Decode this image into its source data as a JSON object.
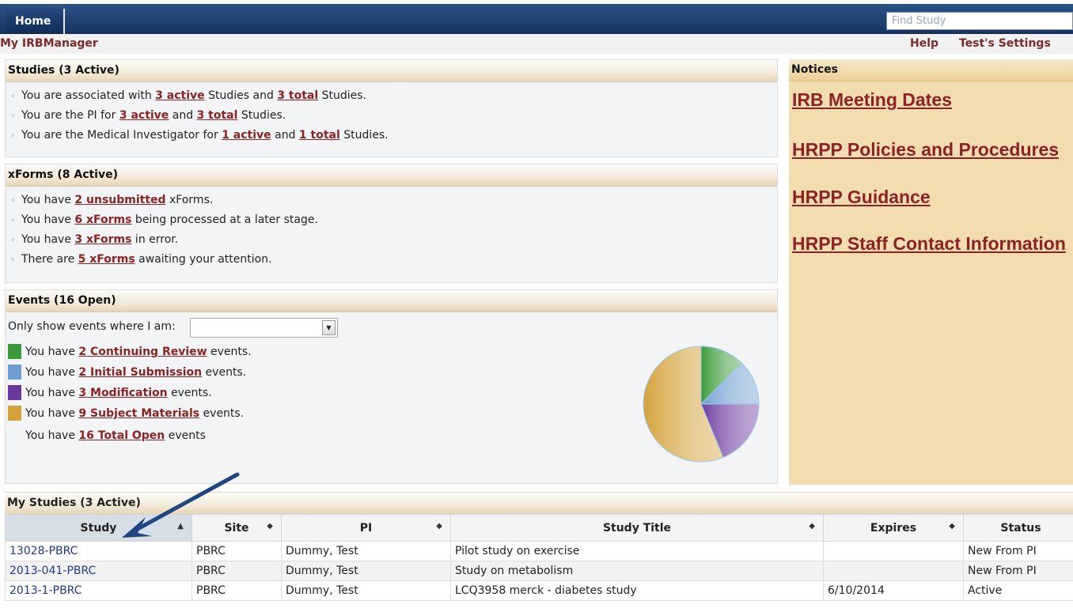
{
  "topbar": {
    "home_tab": "Home",
    "search_placeholder": "Find Study"
  },
  "subbar": {
    "app_name": "My IRBManager",
    "help": "Help",
    "settings": "Test's Settings"
  },
  "studies_panel": {
    "title": "Studies (3 Active)",
    "lines": [
      {
        "pre": "You are associated with ",
        "link1": "3 active",
        "mid": " Studies and ",
        "link2": "3 total",
        "post": " Studies."
      },
      {
        "pre": "You are the PI for ",
        "link1": "3 active",
        "mid": " and ",
        "link2": "3 total",
        "post": " Studies."
      },
      {
        "pre": "You are the Medical Investigator for ",
        "link1": "1 active",
        "mid": " and ",
        "link2": "1 total",
        "post": " Studies."
      }
    ]
  },
  "xforms_panel": {
    "title": "xForms (8 Active)",
    "lines": [
      {
        "pre": "You have ",
        "link": "2 unsubmitted",
        "post": " xForms."
      },
      {
        "pre": "You have ",
        "link": "6 xForms",
        "post": " being processed at a later stage."
      },
      {
        "pre": "You have ",
        "link": "3 xForms",
        "post": " in error."
      },
      {
        "pre": "There are ",
        "link": "5 xForms",
        "post": " awaiting your attention."
      }
    ]
  },
  "events_panel": {
    "title": "Events (16 Open)",
    "filter_label": "Only show events where I am:",
    "filter_value": "",
    "rows": [
      {
        "pre": "You have ",
        "link": "2 Continuing Review",
        "post": " events.",
        "color": "#3a9a3a",
        "count": 2
      },
      {
        "pre": "You have ",
        "link": "2 Initial Submission",
        "post": " events.",
        "color": "#6f9fd0",
        "count": 2
      },
      {
        "pre": "You have ",
        "link": "3 Modification",
        "post": " events.",
        "color": "#6b3a9e",
        "count": 3
      },
      {
        "pre": "You have ",
        "link": "9 Subject Materials",
        "post": " events.",
        "color": "#d4a23a",
        "count": 9
      }
    ],
    "total": {
      "pre": "You have ",
      "link": "16 Total Open",
      "post": " events"
    }
  },
  "notices": {
    "title": "Notices",
    "links": [
      "IRB Meeting Dates",
      "HRPP Policies and Procedures",
      "HRPP Guidance",
      "HRPP Staff Contact Information"
    ]
  },
  "my_studies": {
    "title": "My Studies (3 Active)",
    "columns": [
      "Study",
      "Site",
      "PI",
      "Study Title",
      "Expires",
      "Status"
    ],
    "rows": [
      [
        "13028-PBRC",
        "PBRC",
        "Dummy, Test",
        "Pilot study on exercise",
        "",
        "New From PI"
      ],
      [
        "2013-041-PBRC",
        "PBRC",
        "Dummy, Test",
        "Study on metabolism",
        "",
        "New From PI"
      ],
      [
        "2013-1-PBRC",
        "PBRC",
        "Dummy, Test",
        "LCQ3958 merck - diabetes study",
        "6/10/2014",
        "Active"
      ]
    ]
  },
  "icons": {
    "sort": "sort-icon",
    "dropdown": "chevron-down-icon",
    "annotation": "arrow-annotation"
  }
}
